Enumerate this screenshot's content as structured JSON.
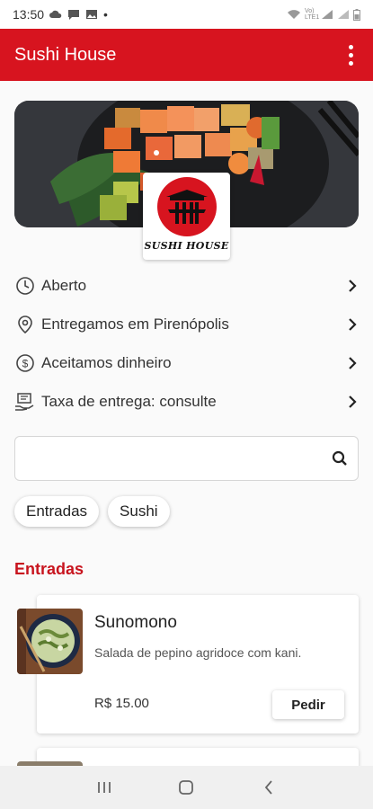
{
  "status_bar": {
    "time": "13:50",
    "dot": "•",
    "network_label": "Vo) LTE1"
  },
  "app_bar": {
    "title": "Sushi House"
  },
  "logo": {
    "text": "SUSHI HOUSE",
    "kanji": "寿司家"
  },
  "info": [
    {
      "icon": "clock-icon",
      "label": "Aberto"
    },
    {
      "icon": "location-pin-icon",
      "label": "Entregamos em Pirenópolis"
    },
    {
      "icon": "dollar-circle-icon",
      "label": "Aceitamos dinheiro"
    },
    {
      "icon": "delivery-fee-icon",
      "label": "Taxa de entrega: consulte"
    }
  ],
  "search": {
    "value": "",
    "placeholder": ""
  },
  "chips": [
    "Entradas",
    "Sushi"
  ],
  "section": {
    "title": "Entradas"
  },
  "product": {
    "name": "Sunomono",
    "description": "Salada de pepino agridoce com kani.",
    "price": "R$ 15.00",
    "order_label": "Pedir"
  },
  "colors": {
    "primary": "#d7141f",
    "section_title": "#c8141e"
  }
}
